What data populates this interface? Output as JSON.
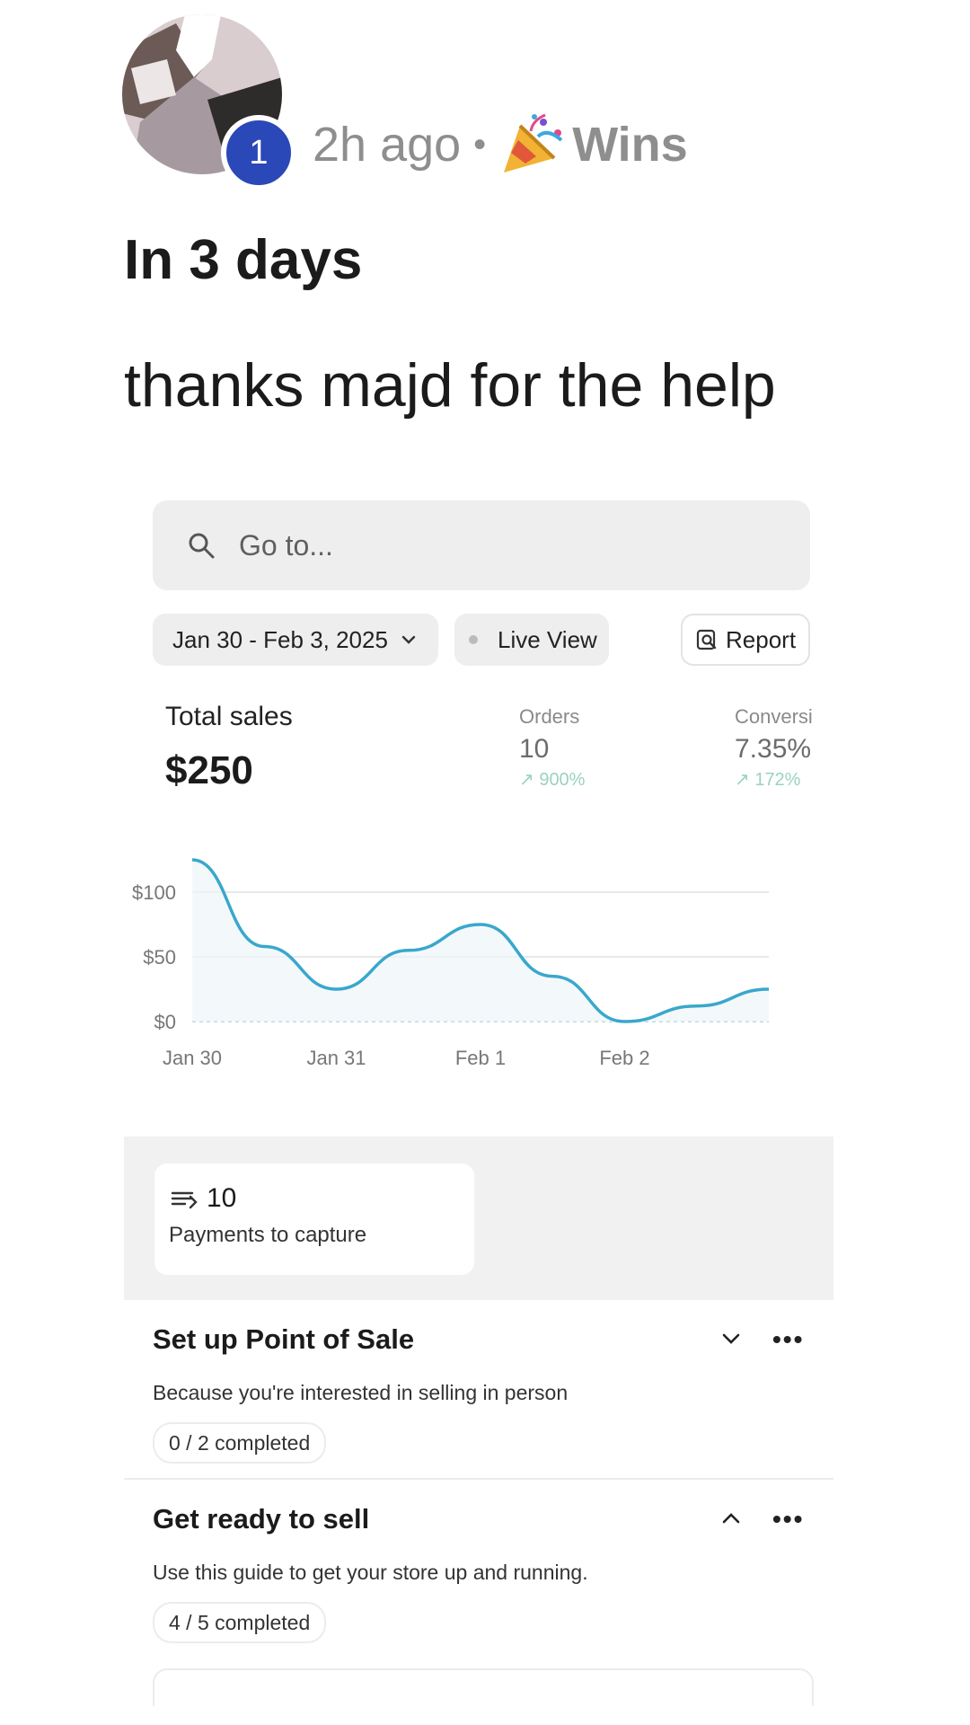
{
  "post": {
    "avatar_badge": "1",
    "time": "2h ago",
    "separator": "•",
    "category": "Wins",
    "category_icon": "party-popper-icon",
    "title": "In 3 days",
    "body": "thanks majd for the help"
  },
  "dashboard": {
    "search": {
      "placeholder": "Go to...",
      "value": ""
    },
    "date_range": "Jan 30 - Feb 3, 2025",
    "live_view": "Live View",
    "report": "Report",
    "total_sales_label": "Total sales",
    "total_sales_value": "$250",
    "orders_label": "Orders",
    "orders_value": "10",
    "orders_change": "↗ 900%",
    "conversion_label": "Conversi",
    "conversion_value": "7.35%",
    "conversion_change": "↗ 172%",
    "payments_count": "10",
    "payments_label": "Payments to capture",
    "tasks": [
      {
        "title": "Set up Point of Sale",
        "desc": "Because you're interested in selling in person",
        "progress": "0 / 2 completed",
        "expanded": false
      },
      {
        "title": "Get ready to sell",
        "desc": "Use this guide to get your store up and running.",
        "progress": "4 / 5 completed",
        "expanded": true
      }
    ],
    "more_label": "•••"
  },
  "chart_data": {
    "type": "line",
    "x": [
      "Jan 30",
      "Jan 30.5",
      "Jan 31",
      "Jan 31.5",
      "Feb 1",
      "Feb 1.5",
      "Feb 2",
      "Feb 2.5",
      "Feb 3"
    ],
    "x_tick_labels": [
      "Jan 30",
      "Jan 31",
      "Feb 1",
      "Feb 2"
    ],
    "y_tick_labels": [
      "$100",
      "$50",
      "$0"
    ],
    "y_ticks": [
      100,
      50,
      0
    ],
    "values": [
      125,
      58,
      25,
      55,
      75,
      35,
      0,
      12,
      25
    ],
    "ylim": [
      0,
      125
    ],
    "line_color": "#3aa7cc",
    "grid": true
  }
}
